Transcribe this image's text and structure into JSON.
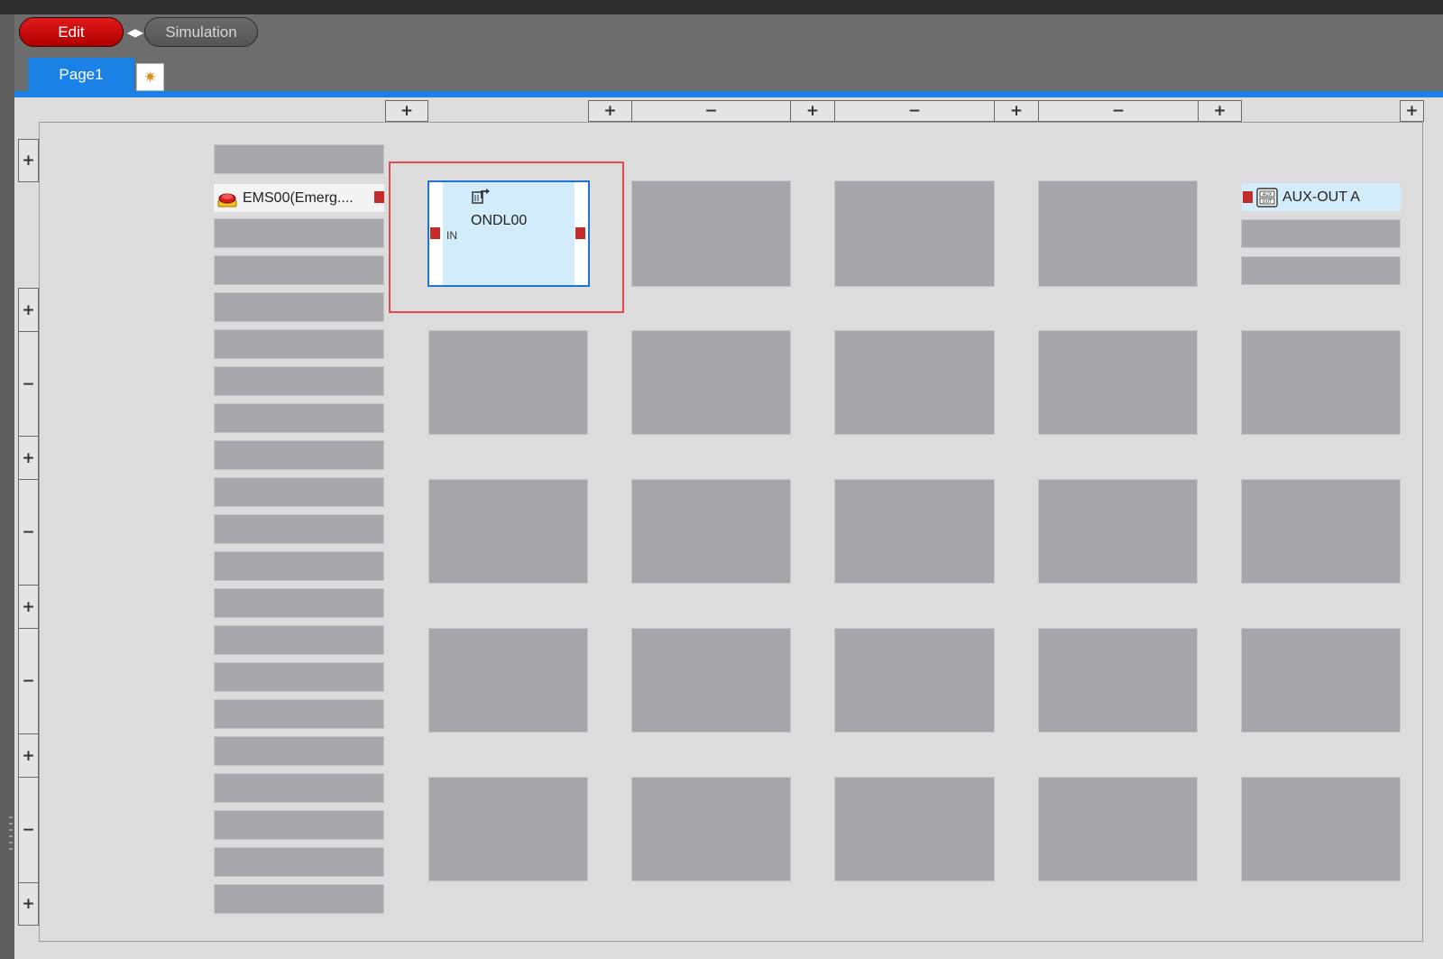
{
  "mode": {
    "edit_label": "Edit",
    "simulation_label": "Simulation",
    "switch_glyph": "◀▶"
  },
  "tabs": {
    "page_label": "Page1",
    "add_glyph": "✷"
  },
  "controls": {
    "plus": "+",
    "minus": "−"
  },
  "inputs": {
    "ems_label": "EMS00(Emerg...."
  },
  "function_block": {
    "name": "ONDL00",
    "input_label": "IN",
    "icon": "on-delay-timer-icon"
  },
  "outputs": {
    "aux_label": "AUX-OUT A",
    "aux_icon": "aux-out-icon"
  },
  "colors": {
    "accent_blue": "#1a82e6",
    "edit_red": "#cc0000",
    "port_red": "#c42b2b",
    "selection_red": "#e04a4a",
    "block_fill": "#d3ecfb"
  }
}
